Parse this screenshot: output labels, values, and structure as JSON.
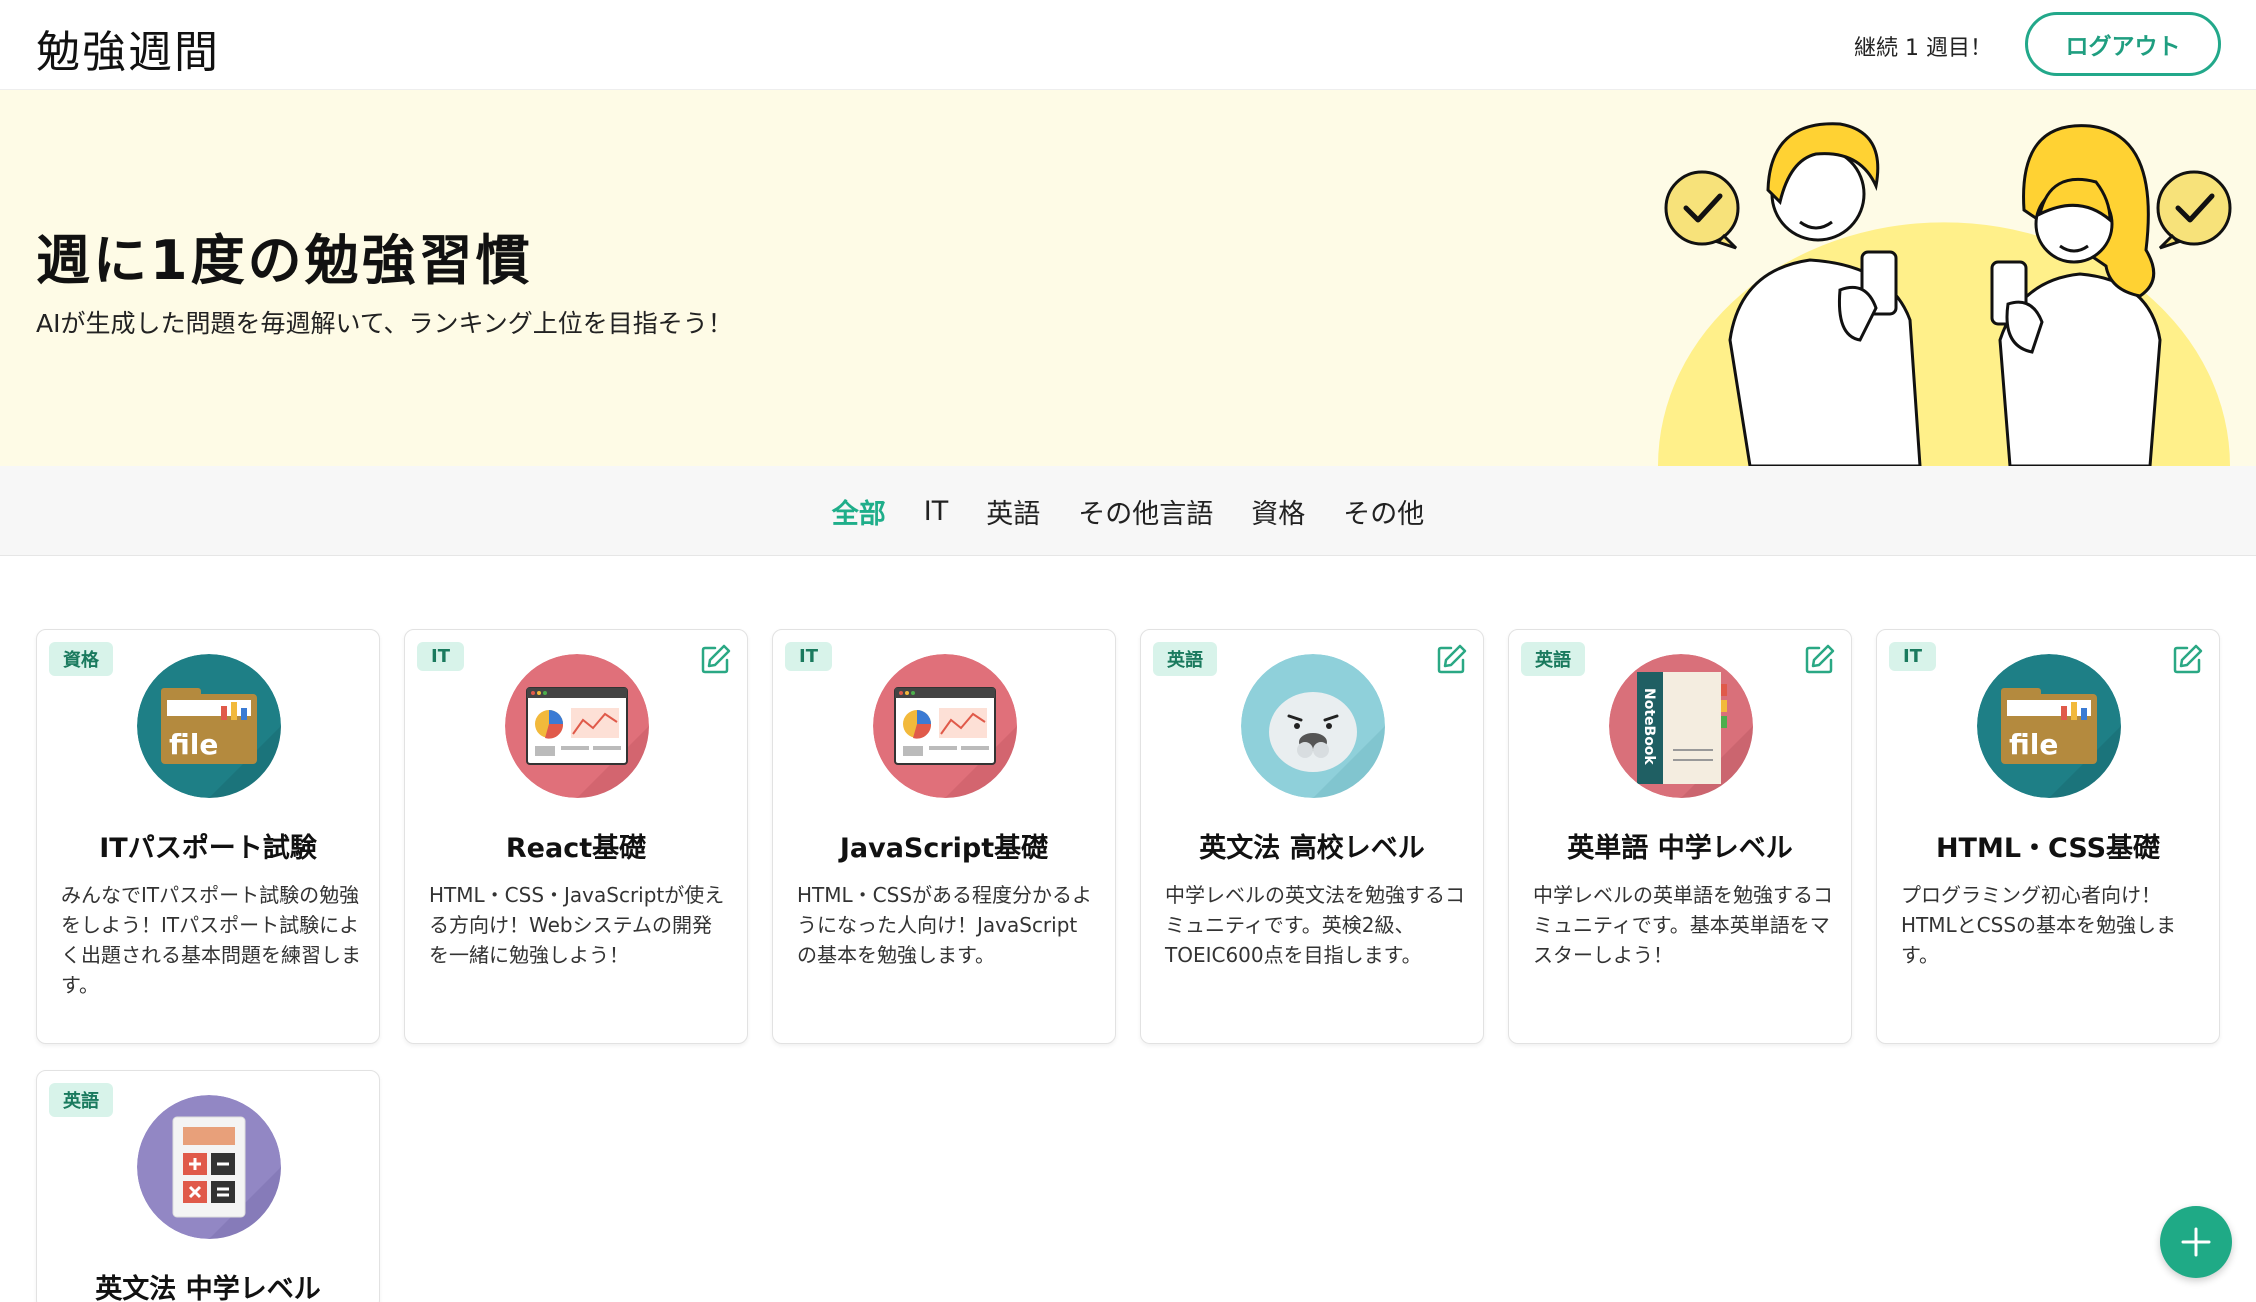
{
  "header": {
    "logo": "勉強週間",
    "streak": "継続 1 週目！",
    "logout_label": "ログアウト"
  },
  "hero": {
    "title": "週に1度の勉強習慣",
    "subtitle": "AIが生成した問題を毎週解いて、ランキング上位を目指そう！"
  },
  "tabs": [
    {
      "label": "全部",
      "active": true
    },
    {
      "label": "IT"
    },
    {
      "label": "英語"
    },
    {
      "label": "その他言語"
    },
    {
      "label": "資格"
    },
    {
      "label": "その他"
    }
  ],
  "cards": [
    {
      "badge": "資格",
      "title": "ITパスポート試験",
      "desc": "みんなでITパスポート試験の勉強をしよう！ITパスポート試験によく出題される基本問題を練習します。",
      "icon": "file-folder-icon",
      "editable": false
    },
    {
      "badge": "IT",
      "title": "React基礎",
      "desc": "HTML・CSS・JavaScriptが使える方向け！Webシステムの開発を一緒に勉強しよう！",
      "icon": "browser-chart-icon",
      "editable": true
    },
    {
      "badge": "IT",
      "title": "JavaScript基礎",
      "desc": "HTML・CSSがある程度分かるようになった人向け！JavaScriptの基本を勉強します。",
      "icon": "browser-chart-icon",
      "editable": false
    },
    {
      "badge": "英語",
      "title": "英文法 高校レベル",
      "desc": "中学レベルの英文法を勉強するコミュニティです。英検2級、TOEIC600点を目指します。",
      "icon": "seal-icon",
      "editable": true
    },
    {
      "badge": "英語",
      "title": "英単語 中学レベル",
      "desc": "中学レベルの英単語を勉強するコミュニティです。基本英単語をマスターしよう！",
      "icon": "notebook-icon",
      "editable": true
    },
    {
      "badge": "IT",
      "title": "HTML・CSS基礎",
      "desc": "プログラミング初心者向け！HTMLとCSSの基本を勉強します。",
      "icon": "file-folder-icon",
      "editable": true
    },
    {
      "badge": "英語",
      "title": "英文法 中学レベル",
      "desc": "",
      "icon": "calculator-icon",
      "editable": false
    }
  ],
  "thumb_text": {
    "file": "file",
    "notebook": "NoteBook"
  },
  "colors": {
    "accent": "#1faa86",
    "hero_bg": "#fefbe6",
    "badge_bg": "#d8f3ea",
    "teal_thumb": "#1e7f86",
    "red_thumb": "#e0707a",
    "light_blue_thumb": "#8fd0da",
    "purple_thumb": "#9287c4"
  }
}
